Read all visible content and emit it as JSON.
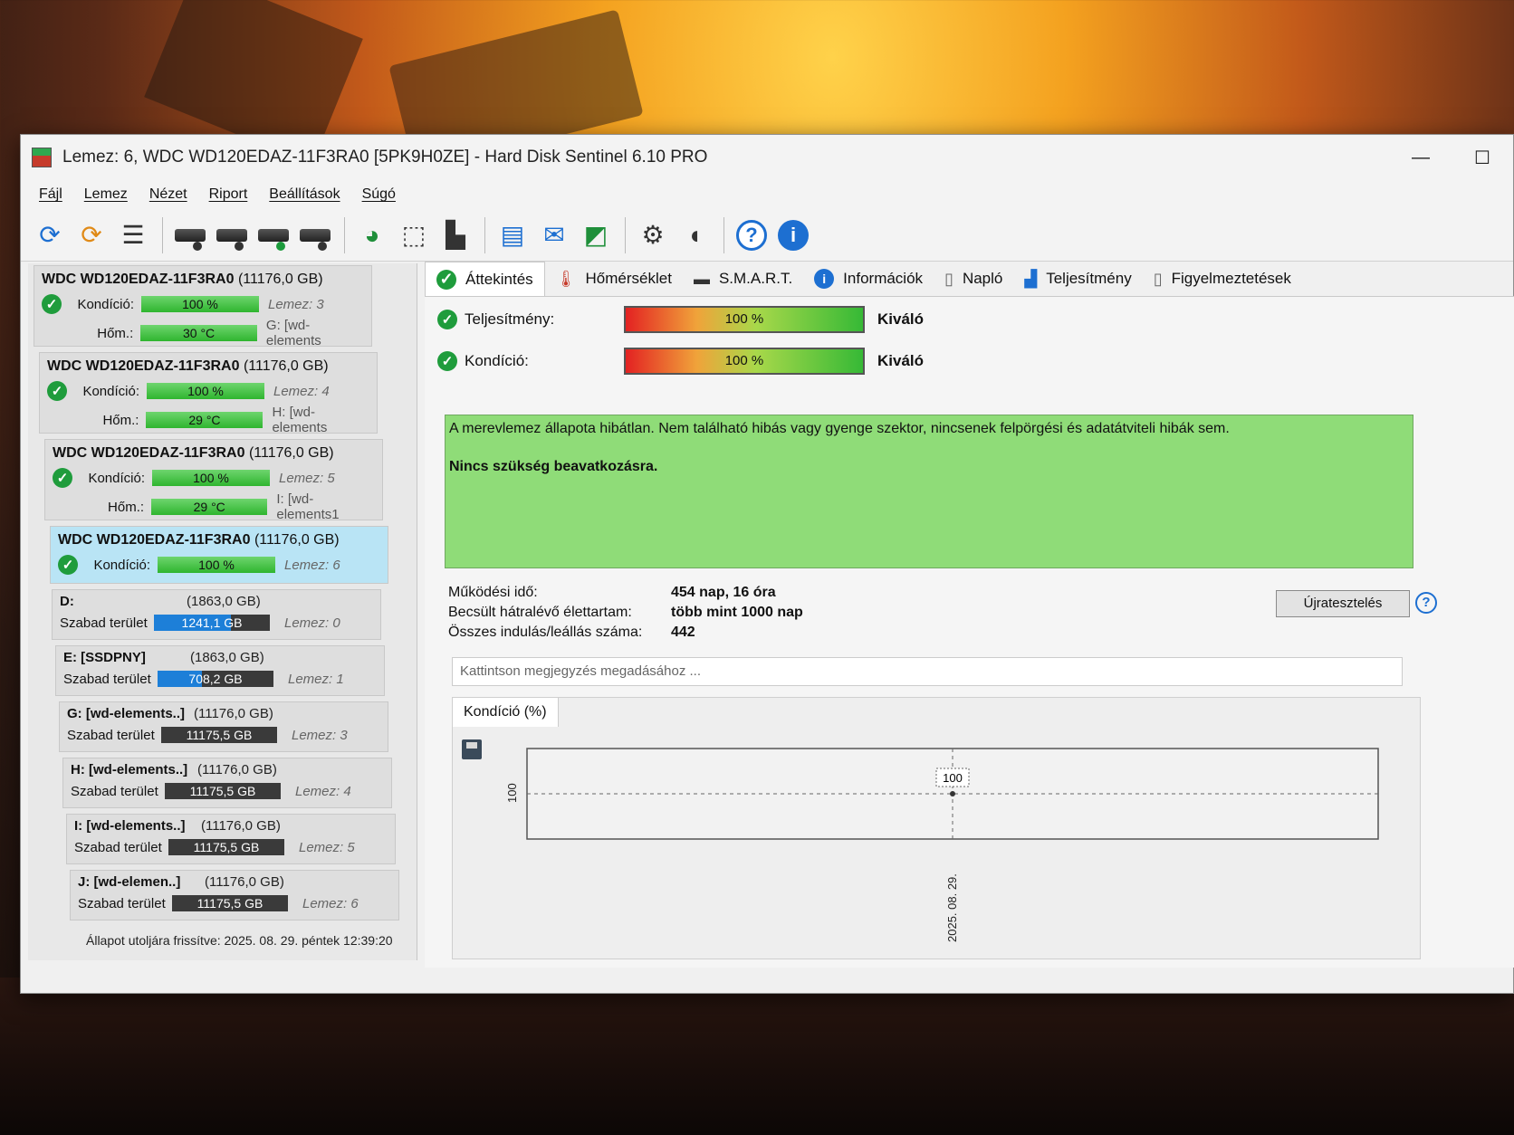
{
  "window": {
    "title": "Lemez: 6, WDC WD120EDAZ-11F3RA0 [5PK9H0ZE]  -  Hard Disk Sentinel 6.10 PRO",
    "minimize": "—",
    "maximize": "☐"
  },
  "menu": [
    "Fájl",
    "Lemez",
    "Nézet",
    "Riport",
    "Beállítások",
    "Súgó"
  ],
  "disks": [
    {
      "model": "WDC WD120EDAZ-11F3RA0",
      "capacity": "(11176,0 GB)",
      "health_label": "Kondíció:",
      "health": "100 %",
      "health_pct": 100,
      "disk_no": "Lemez: 3",
      "temp_label": "Hőm.:",
      "temp": "30 °C",
      "volume": "G: [wd-elements"
    },
    {
      "model": "WDC WD120EDAZ-11F3RA0",
      "capacity": "(11176,0 GB)",
      "health_label": "Kondíció:",
      "health": "100 %",
      "health_pct": 100,
      "disk_no": "Lemez: 4",
      "temp_label": "Hőm.:",
      "temp": "29 °C",
      "volume": "H: [wd-elements"
    },
    {
      "model": "WDC WD120EDAZ-11F3RA0",
      "capacity": "(11176,0 GB)",
      "health_label": "Kondíció:",
      "health": "100 %",
      "health_pct": 100,
      "disk_no": "Lemez: 5",
      "temp_label": "Hőm.:",
      "temp": "29 °C",
      "volume": "I: [wd-elements1"
    },
    {
      "model": "WDC WD120EDAZ-11F3RA0",
      "capacity": "(11176,0 GB)",
      "health_label": "Kondíció:",
      "health": "100 %",
      "health_pct": 100,
      "disk_no": "Lemez: 6"
    }
  ],
  "volumes": [
    {
      "name": "D:",
      "capacity": "(1863,0 GB)",
      "free_label": "Szabad terület",
      "free": "1241,1 GB",
      "free_pct": 66.6,
      "disk_no": "Lemez: 0"
    },
    {
      "name": "E: [SSDPNY]",
      "capacity": "(1863,0 GB)",
      "free_label": "Szabad terület",
      "free": "708,2 GB",
      "free_pct": 38,
      "disk_no": "Lemez: 1"
    },
    {
      "name": "G: [wd-elements..]",
      "capacity": "(11176,0 GB)",
      "free_label": "Szabad terület",
      "free": "11175,5 GB",
      "free_pct": 100,
      "disk_no": "Lemez: 3"
    },
    {
      "name": "H: [wd-elements..]",
      "capacity": "(11176,0 GB)",
      "free_label": "Szabad terület",
      "free": "11175,5 GB",
      "free_pct": 100,
      "disk_no": "Lemez: 4"
    },
    {
      "name": "I: [wd-elements..]",
      "capacity": "(11176,0 GB)",
      "free_label": "Szabad terület",
      "free": "11175,5 GB",
      "free_pct": 100,
      "disk_no": "Lemez: 5"
    },
    {
      "name": "J: [wd-elemen..]",
      "capacity": "(11176,0 GB)",
      "free_label": "Szabad terület",
      "free": "11175,5 GB",
      "free_pct": 100,
      "disk_no": "Lemez: 6"
    }
  ],
  "tabs": [
    "Áttekintés",
    "Hőmérséklet",
    "S.M.A.R.T.",
    "Információk",
    "Napló",
    "Teljesítmény",
    "Figyelmeztetések"
  ],
  "overview": {
    "performance_label": "Teljesítmény:",
    "performance": "100 %",
    "performance_rating": "Kiváló",
    "health_label": "Kondíció:",
    "health": "100 %",
    "health_rating": "Kiváló",
    "status_text": "A merevlemez állapota hibátlan. Nem található hibás vagy gyenge szektor, nincsenek felpörgési és adatátviteli hibák sem.",
    "status_bold": "Nincs szükség beavatkozásra.",
    "power_on_label": "Működési idő:",
    "power_on": "454 nap, 16 óra",
    "lifetime_label": "Becsült hátralévő élettartam:",
    "lifetime": "több mint 1000 nap",
    "starts_label": "Összes indulás/leállás száma:",
    "starts": "442",
    "retest_button": "Újratesztelés",
    "note_placeholder": "Kattintson megjegyzés megadásához ...",
    "chart_tab": "Kondíció  (%)"
  },
  "chart_data": {
    "type": "line",
    "x": [
      "2025. 08. 29."
    ],
    "values": [
      100
    ],
    "point_label": "100",
    "ytick": "100",
    "xtick": "2025. 08. 29."
  },
  "status_bar": "Állapot utoljára frissítve: 2025. 08. 29. péntek 12:39:20",
  "colors": {
    "ok_green": "#1f9c3c",
    "status_bg": "#8fdc78",
    "accent_blue": "#1d7fd8"
  },
  "icons": [
    "refresh-icon",
    "refresh-warning-icon",
    "list-icon",
    "disk-icon",
    "disk-clock-icon",
    "disk-check-icon",
    "disk-search-icon",
    "globe-icon",
    "network-icon",
    "usb-icon",
    "notes-icon",
    "mail-icon",
    "remote-icon",
    "gear-icon",
    "sound-icon",
    "help-icon",
    "info-icon"
  ]
}
